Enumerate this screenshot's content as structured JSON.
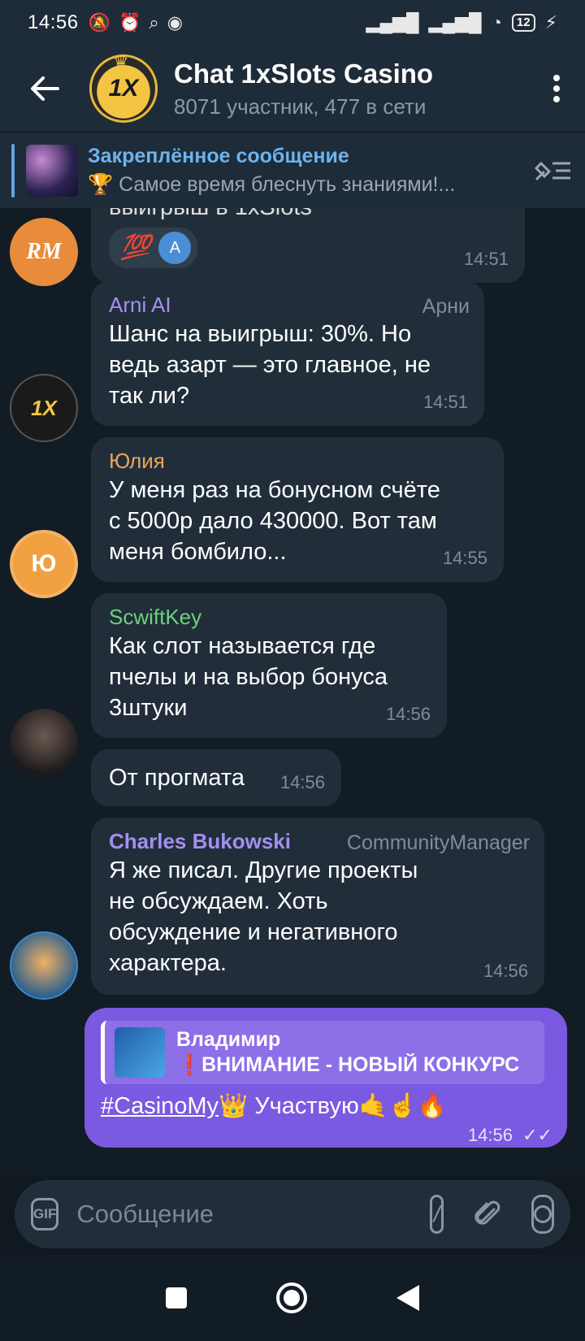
{
  "status_bar": {
    "time": "14:56",
    "battery": "12"
  },
  "header": {
    "title": "Chat 1xSlots Casino",
    "subtitle": "8071 участник, 477 в сети",
    "avatar_text": "1X"
  },
  "pinned": {
    "title": "Закреплённое сообщение",
    "message": "🏆 Самое время блеснуть знаниями!..."
  },
  "messages": [
    {
      "id": "m1",
      "partial_text": "выигрыш в 1xSlots",
      "reaction": "💯",
      "reactor_initial": "A",
      "time": "14:51",
      "avatar_initials": "RM"
    },
    {
      "id": "m2",
      "sender": "Arni AI",
      "rank": "Арни",
      "lines": [
        "Шанс на выигрыш: 30%. Но",
        "ведь азарт — это главное, не",
        "так ли?"
      ],
      "time": "14:51",
      "avatar_initials": "1X"
    },
    {
      "id": "m3",
      "sender": "Юлия",
      "lines": [
        "У меня раз на бонусном счёте",
        "с 5000р дало 430000. Вот там",
        "меня бомбило..."
      ],
      "time": "14:55",
      "avatar_initials": "Ю"
    },
    {
      "id": "m4",
      "sender": "ScwiftKey",
      "lines": [
        "Как слот называется где",
        "пчелы и на выбор бонуса",
        "3штуки"
      ],
      "time": "14:56"
    },
    {
      "id": "m5",
      "text": "От прогмата",
      "time": "14:56"
    },
    {
      "id": "m6",
      "sender": "Charles Bukowski",
      "rank": "CommunityManager",
      "lines": [
        "Я же писал. Другие проекты",
        "не обсуждаем. Хоть",
        "обсуждение и негативного",
        "характера."
      ],
      "time": "14:56"
    },
    {
      "id": "m7",
      "reply_name": "Владимир",
      "reply_text": "❗ВНИМАНИЕ - НОВЫЙ КОНКУРС",
      "hashtag": "#CasinoMy",
      "text": "👑 Участвую🤙☝️🔥",
      "time": "14:56",
      "checks": "✓✓"
    }
  ],
  "input": {
    "placeholder": "Сообщение",
    "gif_label": "GIF",
    "command_label": "/"
  },
  "colors": {
    "background": "#121c25",
    "header": "#1e2b38",
    "bubble": "#212e3a",
    "own_bubble": "#7a5ae0",
    "accent": "#6cb3ee"
  }
}
